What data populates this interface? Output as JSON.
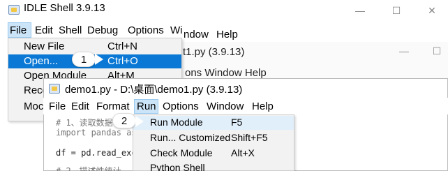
{
  "shell_window": {
    "title": "IDLE Shell 3.9.13",
    "controls": {
      "minimize": "—",
      "maximize": "☐",
      "close": "✕"
    },
    "menubar": [
      "File",
      "Edit",
      "Shell",
      "Debug",
      "Options",
      "Wi"
    ]
  },
  "file_menu": {
    "items": [
      {
        "label": "New File",
        "shortcut": "Ctrl+N"
      },
      {
        "label": "Open...",
        "shortcut": "Ctrl+O"
      },
      {
        "label": "Open Module",
        "shortcut": "Alt+M"
      },
      {
        "label": "Rece",
        "shortcut": ""
      },
      {
        "label": "Moc",
        "shortcut": ""
      }
    ]
  },
  "middle_window": {
    "title": "t1.py (3.9.13)",
    "menu_fragment_left": "ndow",
    "menu_fragment_help": "Help",
    "menu_fragment2": "ons  Window  Help",
    "controls": {
      "minimize": "—",
      "maximize": "☐"
    }
  },
  "editor_window": {
    "title": "demo1.py - D:\\桌面\\demo1.py (3.9.13)",
    "menubar": [
      "File",
      "Edit",
      "Format",
      "Run",
      "Options",
      "Window",
      "Help"
    ],
    "code_lines": [
      "# 1、读取数据",
      "import pandas as",
      "",
      "df = pd.read_exc",
      "",
      "# 2、描述性统计"
    ]
  },
  "run_menu": {
    "items": [
      {
        "label": "Run Module",
        "shortcut": "F5"
      },
      {
        "label": "Run... Customized",
        "shortcut": "Shift+F5"
      },
      {
        "label": "Check Module",
        "shortcut": "Alt+X"
      },
      {
        "label": "Python Shell",
        "shortcut": ""
      }
    ]
  },
  "steps": {
    "step1": "1",
    "step2": "2"
  }
}
